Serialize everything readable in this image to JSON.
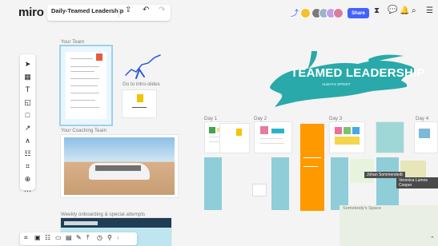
{
  "app": {
    "logo": "miro",
    "board_name": "Daily-Teamed Leadership",
    "share_label": "Share",
    "star_icon": "star-icon"
  },
  "canvas": {
    "your_team_label": "Your Team",
    "coaching_team_label": "Your Coaching Team",
    "intro_label": "Go to intro-slides",
    "welcome_label": "Weekly onboarding & special attempts",
    "day1_label": "Day 1",
    "day2_label": "Day 2",
    "day3_label": "Day 3",
    "day4_label": "Day 4",
    "day_label_1": "Day 1",
    "title_main": "TEAMED LEADERSHIP",
    "title_sub": "ALWAYS SPRINT",
    "cursor_1": "Johan Sommerstedt",
    "cursor_2": "Veronica Lumos Cooper",
    "space_label": "Somebody's Space"
  },
  "colors": {
    "teal": "#2aa9a7",
    "orange": "#ff9900",
    "blue": "#4262ff",
    "green": "#7bc36b",
    "yellow": "#f5d54b",
    "pink": "#f7a9c5",
    "purple": "#a783d6"
  }
}
